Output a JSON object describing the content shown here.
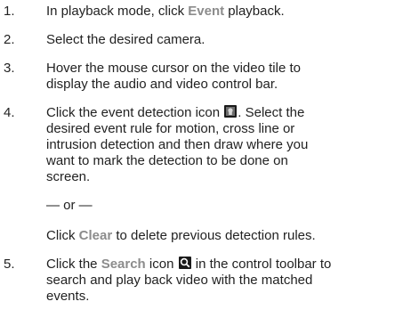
{
  "steps": [
    {
      "num": "1.",
      "pre": "In playback mode, click ",
      "kw": "Event",
      "post": " playback."
    },
    {
      "num": "2.",
      "text": "Select the desired camera."
    },
    {
      "num": "3.",
      "line1": "Hover the mouse cursor on the video tile to",
      "line2": "display the audio and video control bar."
    },
    {
      "num": "4.",
      "l1a": "Click the event detection icon ",
      "l1b": ". Select the",
      "l2": "desired event rule for motion, cross line or",
      "l3": "intrusion detection and then draw where you",
      "l4": "want to mark the detection to be done on",
      "l5": "screen.",
      "or": "— or —",
      "clear_pre": "Click ",
      "clear_kw": "Clear",
      "clear_post": " to delete previous detection rules."
    },
    {
      "num": "5.",
      "l1a": "Click the ",
      "l1kw": "Search",
      "l1b": " icon ",
      "l1c": " in the control toolbar to",
      "l2": "search and play back video with the matched",
      "l3": "events."
    }
  ],
  "icons": {
    "event_detection": "event-detection-icon",
    "search": "search-icon"
  },
  "colors": {
    "keyword": "#8c8c8c",
    "icon_bg": "#1a1a1a"
  }
}
